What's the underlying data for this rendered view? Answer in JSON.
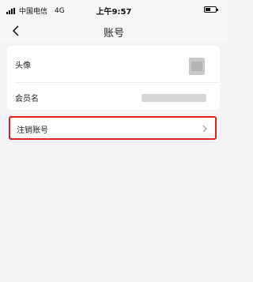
{
  "status_bar": {
    "carrier": "中国电信",
    "network": "4G",
    "time": "上午9:57"
  },
  "nav": {
    "back_icon": "chevron-left-icon",
    "title": "账号"
  },
  "profile": {
    "avatar_label": "头像",
    "member_name_label": "会员名"
  },
  "account_actions": {
    "deregister_label": "注销账号",
    "chevron_icon": "chevron-right-icon",
    "highlight_color": "#e02020"
  }
}
